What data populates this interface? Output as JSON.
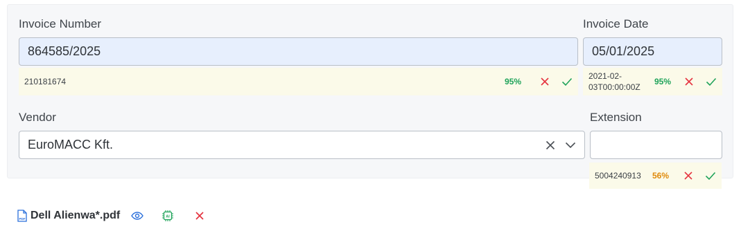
{
  "invoice_number": {
    "label": "Invoice Number",
    "value": "864585/2025",
    "suggestion": "210181674",
    "confidence": "95%"
  },
  "invoice_date": {
    "label": "Invoice Date",
    "value": "05/01/2025",
    "suggestion_line1": "2021-02-",
    "suggestion_line2": "03T00:00:00Z",
    "confidence": "95%"
  },
  "vendor": {
    "label": "Vendor",
    "value": "EuroMACC Kft."
  },
  "extension": {
    "label": "Extension",
    "value": "",
    "suggestion": "5004240913",
    "confidence": "56%"
  },
  "attachment": {
    "file_name": "Dell Alienwa*.pdf",
    "pdf_badge": "PDF",
    "ai_badge": "AI"
  },
  "colors": {
    "accept": "#1fa35a",
    "reject": "#e5333f",
    "medium_confidence": "#e08a0b",
    "view": "#2a6fdb"
  }
}
